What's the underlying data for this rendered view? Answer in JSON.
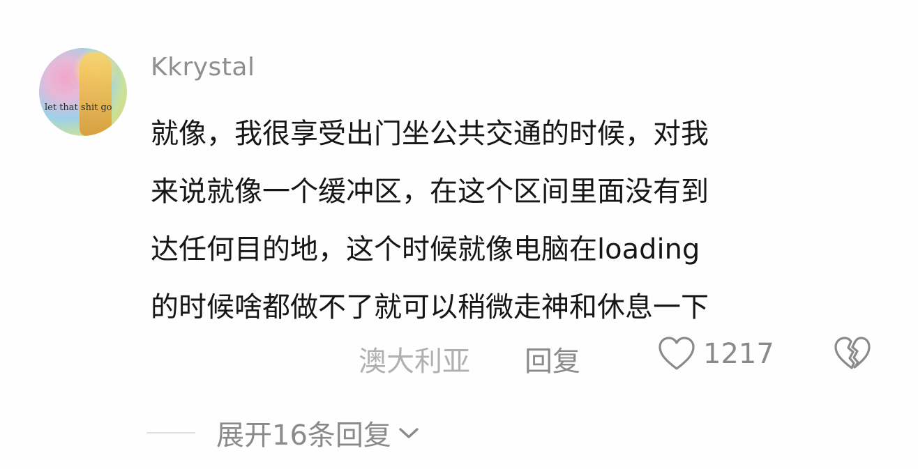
{
  "comment": {
    "avatar": {
      "caption": "let that shit go",
      "icon": "avatar-image"
    },
    "username": "Kkrystal",
    "lines": [
      "就像，我很享受出门坐公共交通的时候，对我",
      "来说就像一个缓冲区，在这个区间里面没有到",
      "达任何目的地，这个时候就像电脑在loading",
      "的时候啥都做不了就可以稍微走神和休息一下"
    ],
    "location": "澳大利亚",
    "reply_label": "回复",
    "like_count": "1217",
    "icons": {
      "like": "heart-outline-icon",
      "dislike": "broken-heart-icon",
      "expand": "chevron-down-icon"
    }
  },
  "replies": {
    "expand_label": "展开16条回复"
  },
  "colors": {
    "text_primary": "#161616",
    "text_secondary": "#8a8a8a",
    "text_muted": "#b0b0b0"
  }
}
